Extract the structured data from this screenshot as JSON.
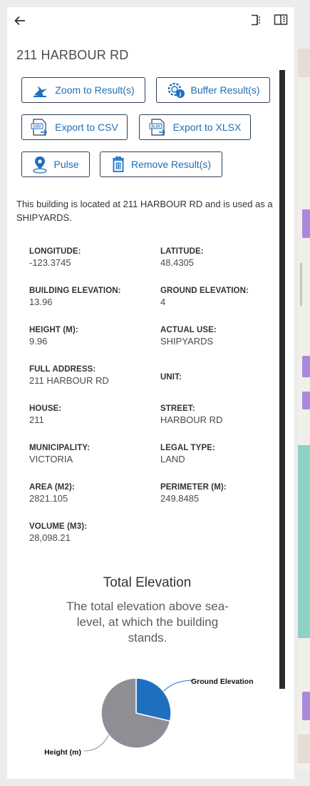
{
  "header": {
    "title": "211 HARBOUR RD"
  },
  "actions": {
    "zoom": "Zoom to Result(s)",
    "buffer": "Buffer Result(s)",
    "csv": "Export to CSV",
    "csv_icon_text": "CSV",
    "xlsx": "Export to XLSX",
    "xlsx_icon_text": "XLSX",
    "pulse": "Pulse",
    "remove": "Remove Result(s)"
  },
  "description": "This building is located at 211 HARBOUR RD and is used as a SHIPYARDS.",
  "attributes": [
    {
      "label": "LONGITUDE:",
      "value": "-123.3745"
    },
    {
      "label": "LATITUDE:",
      "value": "48.4305"
    },
    {
      "label": "BUILDING ELEVATION:",
      "value": "13.96"
    },
    {
      "label": "GROUND ELEVATION:",
      "value": "4"
    },
    {
      "label": "HEIGHT (M):",
      "value": "9.96"
    },
    {
      "label": "ACTUAL USE:",
      "value": "SHIPYARDS"
    },
    {
      "label": "FULL ADDRESS:",
      "value": "211 HARBOUR RD"
    },
    {
      "label": "UNIT:",
      "value": ""
    },
    {
      "label": "HOUSE:",
      "value": "211"
    },
    {
      "label": "STREET:",
      "value": "HARBOUR RD"
    },
    {
      "label": "MUNICIPALITY:",
      "value": "VICTORIA"
    },
    {
      "label": "LEGAL TYPE:",
      "value": "LAND"
    },
    {
      "label": "AREA (M2):",
      "value": "2821.105"
    },
    {
      "label": "PERIMETER (M):",
      "value": "249.8485"
    },
    {
      "label": "VOLUME (M3):",
      "value": "28,098.21"
    }
  ],
  "chart_data": {
    "type": "pie",
    "title": "Total Elevation",
    "subtitle": "The total elevation above sea-level, at which the building stands.",
    "slices": [
      {
        "label": "Ground Elevation",
        "value": 4,
        "color": "#1f6fc0"
      },
      {
        "label": "Height (m)",
        "value": 9.96,
        "color": "#8e8e94"
      }
    ]
  }
}
